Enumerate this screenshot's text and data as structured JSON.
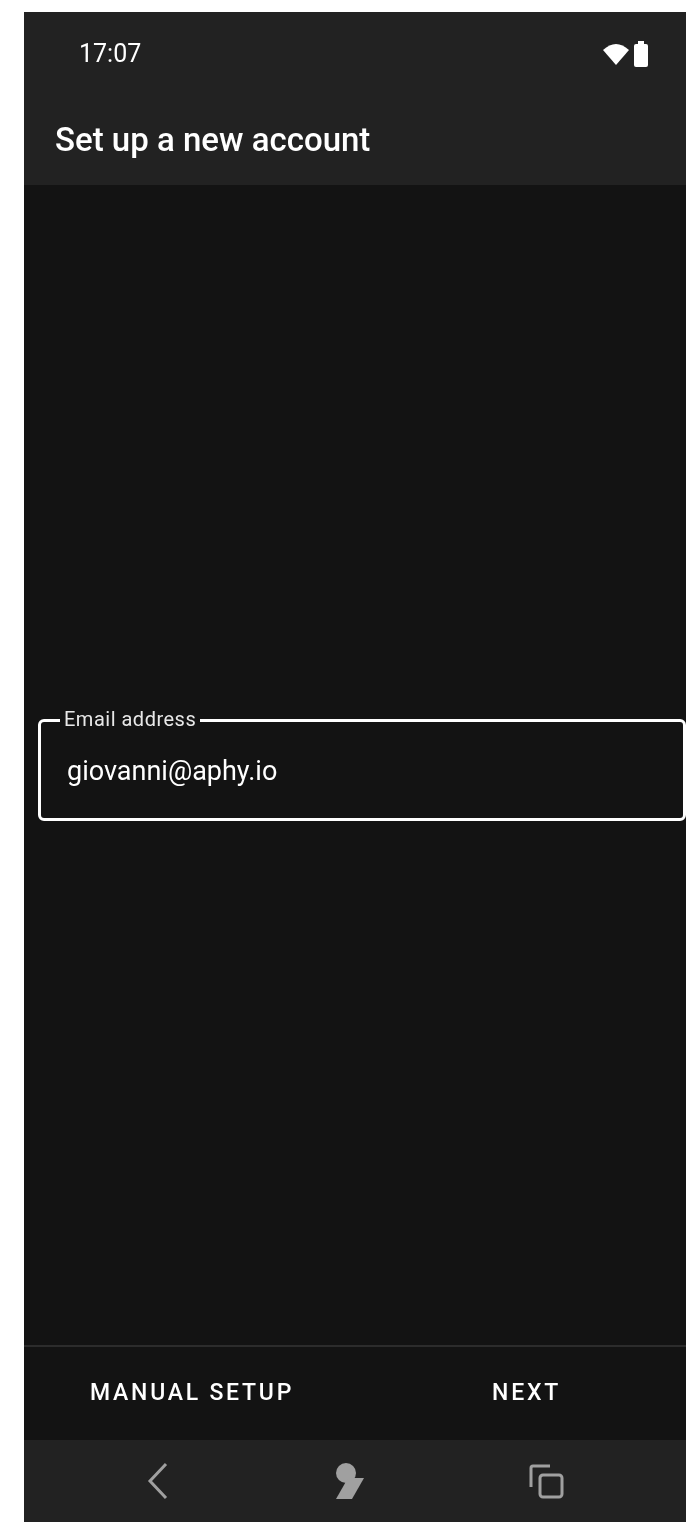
{
  "status_bar": {
    "time": "17:07"
  },
  "app_bar": {
    "title": "Set up a new account"
  },
  "email_field": {
    "label": "Email address",
    "value": "giovanni@aphy.io"
  },
  "buttons": [
    {
      "label": "MANUAL SETUP"
    },
    {
      "label": "NEXT"
    }
  ]
}
